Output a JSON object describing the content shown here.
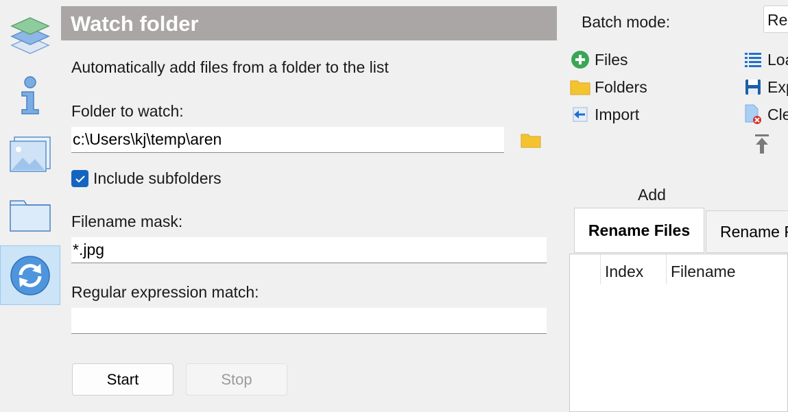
{
  "header": {
    "title": "Watch folder"
  },
  "description": "Automatically add files from a folder to the list",
  "folder": {
    "label": "Folder to watch:",
    "value": "c:\\Users\\kj\\temp\\aren"
  },
  "include_subfolders": {
    "label": "Include subfolders",
    "checked": true
  },
  "mask": {
    "label": "Filename mask:",
    "value": "*.jpg"
  },
  "regex": {
    "label": "Regular expression match:",
    "value": ""
  },
  "buttons": {
    "start": "Start",
    "stop": "Stop"
  },
  "batch": {
    "label": "Batch mode:",
    "value": "Ren"
  },
  "add_commands": {
    "files": "Files",
    "folders": "Folders",
    "import": "Import",
    "group_label": "Add"
  },
  "list_commands": {
    "load": "Loa",
    "export": "Exp",
    "clear": "Cle"
  },
  "tabs": [
    "Rename Files",
    "Rename F"
  ],
  "grid": {
    "columns": [
      "Index",
      "Filename"
    ]
  },
  "colors": {
    "header_bg": "#aaa6a6",
    "accent": "#1565c0",
    "nav_active": "#cce4f7"
  },
  "icons": [
    "layers-icon",
    "info-icon",
    "images-icon",
    "folder-icon",
    "sync-icon",
    "folder-browse-icon",
    "add-circle-icon",
    "import-icon",
    "list-icon",
    "save-icon",
    "clear-file-icon",
    "move-up-icon",
    "checkmark-icon"
  ]
}
